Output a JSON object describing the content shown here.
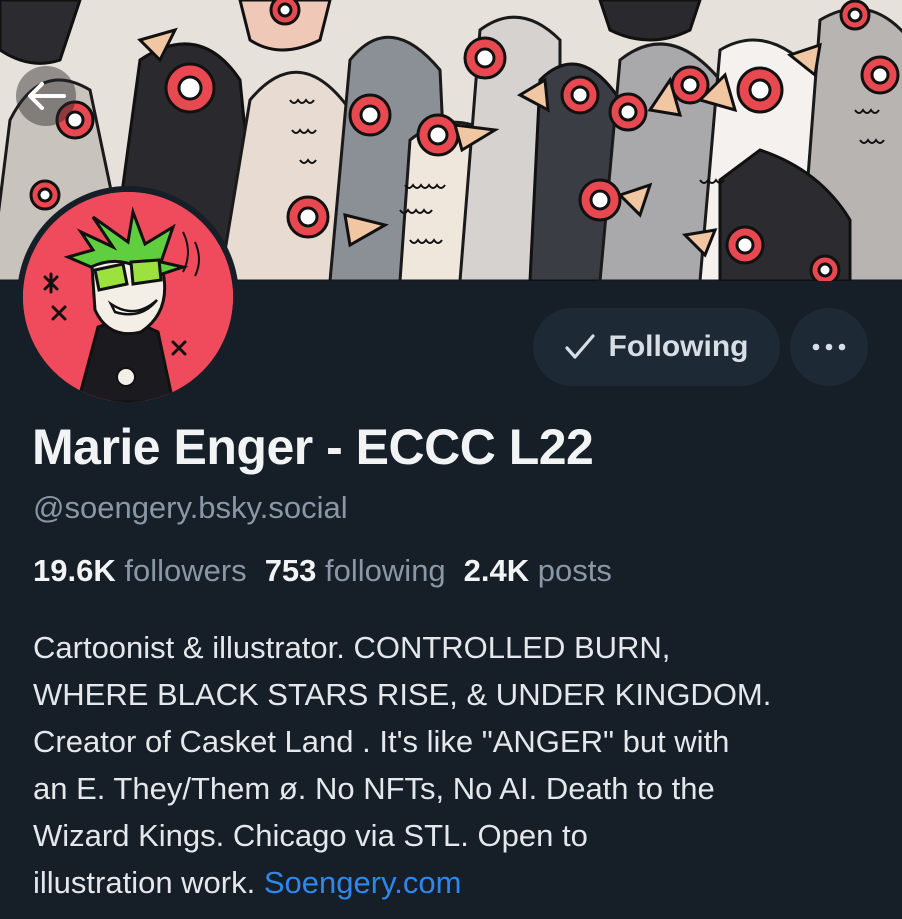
{
  "profile": {
    "display_name": "Marie Enger - ECCC L22",
    "handle": "@soengery.bsky.social",
    "follow_button_label": "Following",
    "stats": {
      "followers_count": "19.6K",
      "followers_label": "followers",
      "following_count": "753",
      "following_label": "following",
      "posts_count": "2.4K",
      "posts_label": "posts"
    },
    "bio": {
      "line1": "Cartoonist & illustrator. CONTROLLED BURN,",
      "line2": "WHERE BLACK STARS RISE, & UNDER KINGDOM.",
      "line3": "Creator of Casket Land . It's like \"ANGER\" but with",
      "line4": "an E. They/Them ø. No NFTs, No AI. Death to the",
      "line5": "Wizard Kings. Chicago via STL. Open to",
      "line6_text": "illustration work. ",
      "link_text": "Soengery.com"
    }
  },
  "icons": {
    "back": "arrow-left-icon",
    "following_check": "check-icon",
    "more": "ellipsis-icon"
  },
  "colors": {
    "background": "#161e27",
    "button_bg": "#1e2936",
    "link": "#2f87ee",
    "avatar_bg": "#ef4b5c"
  }
}
